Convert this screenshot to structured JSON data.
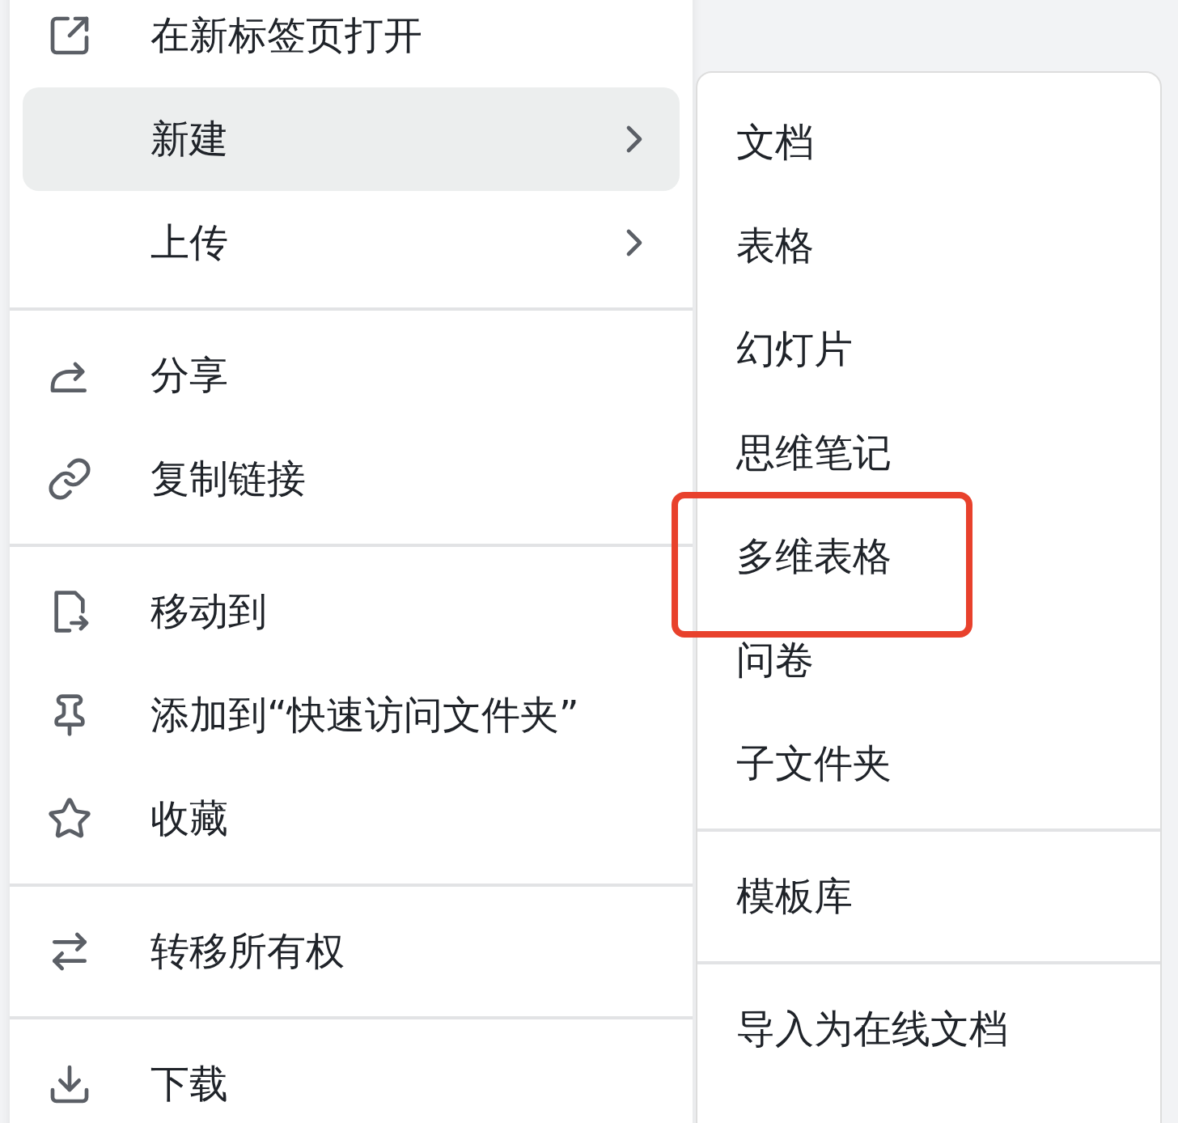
{
  "context_menu": {
    "sections": [
      [
        {
          "label": "在新标签页打开",
          "selected": false,
          "has_submenu": false
        },
        {
          "label": "新建",
          "selected": true,
          "has_submenu": true
        },
        {
          "label": "上传",
          "selected": false,
          "has_submenu": true
        }
      ],
      [
        {
          "label": "分享",
          "selected": false,
          "has_submenu": false
        },
        {
          "label": "复制链接",
          "selected": false,
          "has_submenu": false
        }
      ],
      [
        {
          "label": "移动到",
          "selected": false,
          "has_submenu": false
        },
        {
          "label": "添加到“快速访问文件夹”",
          "selected": false,
          "has_submenu": false
        },
        {
          "label": "收藏",
          "selected": false,
          "has_submenu": false
        }
      ],
      [
        {
          "label": "转移所有权",
          "selected": false,
          "has_submenu": false
        }
      ],
      [
        {
          "label": "下载",
          "selected": false,
          "has_submenu": false
        }
      ]
    ]
  },
  "submenu": {
    "sections": [
      [
        {
          "label": "文档",
          "highlighted": false
        },
        {
          "label": "表格",
          "highlighted": false
        },
        {
          "label": "幻灯片",
          "highlighted": false
        },
        {
          "label": "思维笔记",
          "highlighted": false
        },
        {
          "label": "多维表格",
          "highlighted": true
        },
        {
          "label": "问卷",
          "highlighted": false
        },
        {
          "label": "子文件夹",
          "highlighted": false
        }
      ],
      [
        {
          "label": "模板库",
          "highlighted": false
        }
      ],
      [
        {
          "label": "导入为在线文档",
          "highlighted": false
        }
      ]
    ]
  }
}
